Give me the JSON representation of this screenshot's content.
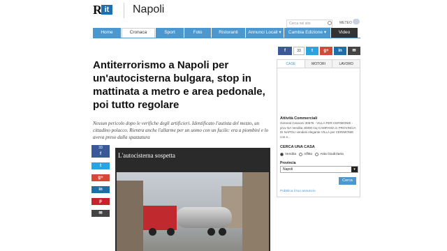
{
  "header": {
    "logo_letter": "R",
    "logo_box": "it",
    "city": "Napoli",
    "search_placeholder": "Cerca nel sito",
    "meteo_label": "METEO"
  },
  "nav": {
    "items": [
      "Home",
      "Cronaca",
      "Sport",
      "Foto",
      "Ristoranti",
      "Annunci Locali ▾",
      "Cambia Edizione ▾",
      "Video"
    ]
  },
  "article": {
    "headline": "Antiterrorismo a Napoli per un'autocisterna bulgara, stop in mattinata a metro e area pedonale, poi tutto regolare",
    "summary": "Nessun pericolo dopo le verifiche degli artificieri. Identificato l'autista del mezzo, un cittadino polacco. Rientra anche l'allarme per un uomo con un fucile: era a piombini e lo aveva preso dalla spazzatura",
    "photo_caption": "L'autocisterna sospetta"
  },
  "share": {
    "facebook_count": "33",
    "facebook": "f",
    "twitter": "t",
    "googleplus": "g+",
    "linkedin": "in",
    "pinterest": "p",
    "email": "✉"
  },
  "social_top": {
    "facebook": "f",
    "count": "33",
    "twitter": "t",
    "googleplus": "g+",
    "linkedin": "in",
    "email": "✉"
  },
  "classifieds": {
    "tabs": [
      "CASE",
      "MOTORI",
      "LAVORO"
    ],
    "category_title": "Attività Commerciali",
    "category_text": "General Cessioni 30676 - VILLA PER CERIMONIE - prov NA Vendita 40000 mq CAMPANIA in PROVINCIA DI NAPOLI vendesi elegante VILLA per CERIMONIE con e...",
    "search_title": "CERCA UNA CASA",
    "radio_options": [
      "Vendita",
      "Affitto",
      "Asta Giudiziaria"
    ],
    "province_label": "Provincia",
    "province_value": "Napoli",
    "search_button": "Cerca",
    "publish_link": "Pubblica il tuo annuncio"
  }
}
